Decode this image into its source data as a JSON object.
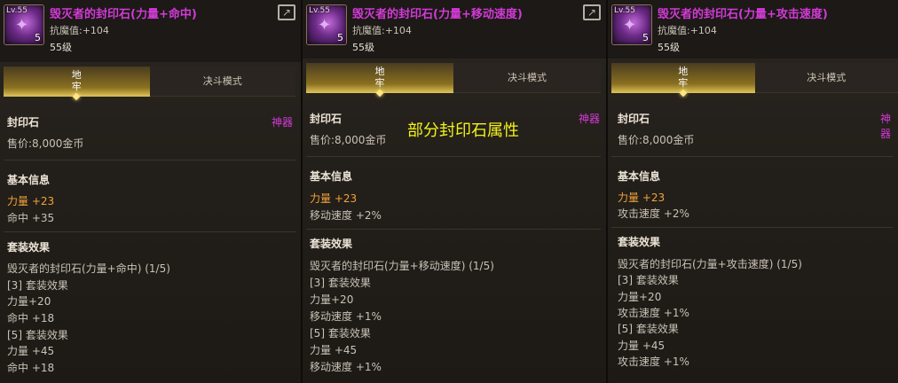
{
  "panels": [
    {
      "icon": {
        "level": "Lv.55",
        "stack": "5"
      },
      "name": "毁灭者的封印石(力量+命中)",
      "sub": "抗魔值:+104",
      "level": "55级",
      "tabs": {
        "dungeon_1": "地",
        "dungeon_2": "牢",
        "duel": "决斗模式"
      },
      "category": "封印石",
      "rarity": "神器",
      "price": "售价:8,000金币",
      "basic_title": "基本信息",
      "basic_1": "力量 +23",
      "basic_2": "命中 +35",
      "set_title": "套装效果",
      "set_lines": [
        "毁灭者的封印石(力量+命中) (1/5)",
        "[3] 套装效果",
        "力量+20",
        "命中 +18",
        "[5] 套装效果",
        "力量 +45",
        "命中 +18"
      ]
    },
    {
      "icon": {
        "level": "Lv.55",
        "stack": "5"
      },
      "name": "毁灭者的封印石(力量+移动速度)",
      "sub": "抗魔值:+104",
      "level": "55级",
      "tabs": {
        "dungeon_1": "地",
        "dungeon_2": "牢",
        "duel": "决斗模式"
      },
      "category": "封印石",
      "rarity": "神器",
      "price": "售价:8,000金币",
      "basic_title": "基本信息",
      "basic_1": "力量 +23",
      "basic_2": "移动速度 +2%",
      "set_title": "套装效果",
      "set_lines": [
        "毁灭者的封印石(力量+移动速度) (1/5)",
        "[3] 套装效果",
        "力量+20",
        "移动速度 +1%",
        "[5] 套装效果",
        "力量 +45",
        "移动速度 +1%"
      ]
    },
    {
      "icon": {
        "level": "Lv.55",
        "stack": "5"
      },
      "name": "毁灭者的封印石(力量+攻击速度)",
      "sub": "抗魔值:+104",
      "level": "55级",
      "tabs": {
        "dungeon_1": "地",
        "dungeon_2": "牢",
        "duel": "决斗模式"
      },
      "category": "封印石",
      "rarity": "神器",
      "price": "售价:8,000金币",
      "basic_title": "基本信息",
      "basic_1": "力量 +23",
      "basic_2": "攻击速度 +2%",
      "set_title": "套装效果",
      "set_lines": [
        "毁灭者的封印石(力量+攻击速度) (1/5)",
        "[3] 套装效果",
        "力量+20",
        "攻击速度 +1%",
        "[5] 套装效果",
        "力量 +45",
        "攻击速度 +1%"
      ]
    }
  ],
  "overlay_title": "部分封印石属性",
  "colors": {
    "name": "#d33ad8",
    "gold": "#f2a33a",
    "overlay": "#f2f21a"
  }
}
